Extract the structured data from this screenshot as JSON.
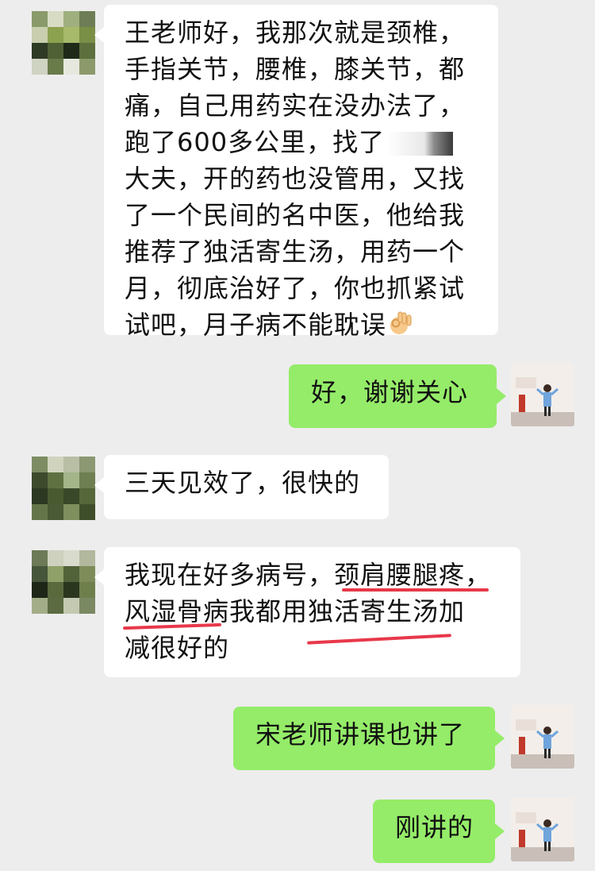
{
  "messages": [
    {
      "side": "left",
      "lines": [
        "王老师好，我那次就是颈椎，",
        "手指关节，腰椎，膝关节，都",
        "痛，自己用药实在没办法了，",
        "跑了600多公里，找了",
        "大夫，开的药也没管用，又找",
        "了一个民间的名中医，他给我",
        "推荐了独活寄生汤，用药一个",
        "月，彻底治好了，你也抓紧试",
        "试吧，月子病不能耽误"
      ],
      "emoji": "ok-hand-icon"
    },
    {
      "side": "right",
      "text": "好，谢谢关心"
    },
    {
      "side": "left",
      "text": "三天见效了，很快的"
    },
    {
      "side": "left",
      "lines": [
        "我现在好多病号，颈肩腰腿疼，",
        "风湿骨病我都用独活寄生汤加",
        "减很好的"
      ]
    },
    {
      "side": "right",
      "text": "宋老师讲课也讲了"
    },
    {
      "side": "right",
      "text": "刚讲的"
    }
  ],
  "colors": {
    "background": "#ededed",
    "left_bubble": "#ffffff",
    "right_bubble": "#95ec69",
    "underline": "#e8384a"
  }
}
